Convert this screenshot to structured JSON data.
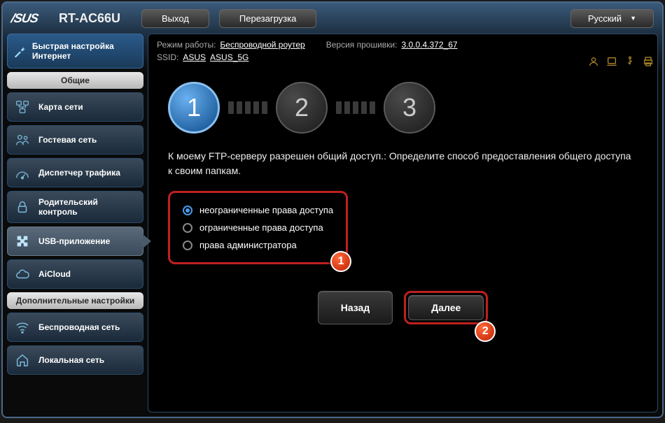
{
  "header": {
    "brand": "/SUS",
    "model": "RT-AC66U",
    "logout": "Выход",
    "reboot": "Перезагрузка",
    "language": "Русский"
  },
  "info": {
    "mode_label": "Режим работы:",
    "mode_value": "Беспроводной роутер",
    "fw_label": "Версия прошивки:",
    "fw_value": "3.0.0.4.372_67",
    "ssid_label": "SSID:",
    "ssid_1": "ASUS",
    "ssid_2": "ASUS_5G"
  },
  "sidebar": {
    "quick_setup": "Быстрая настройка Интернет",
    "general_header": "Общие",
    "items": [
      {
        "label": "Карта сети"
      },
      {
        "label": "Гостевая сеть"
      },
      {
        "label": "Диспетчер трафика"
      },
      {
        "label": "Родительский контроль"
      },
      {
        "label": "USB-приложение"
      },
      {
        "label": "AiCloud"
      }
    ],
    "advanced_header": "Дополнительные настройки",
    "adv_items": [
      {
        "label": "Беспроводная сеть"
      },
      {
        "label": "Локальная сеть"
      }
    ]
  },
  "main": {
    "instruction": "К моему FTP-серверу разрешен общий доступ.: Определите способ предоставления общего доступа к своим папкам.",
    "options": [
      "неограниченные права доступа",
      "ограниченные права доступа",
      "права администратора"
    ],
    "back": "Назад",
    "next": "Далее"
  },
  "annotations": {
    "b1": "1",
    "b2": "2"
  }
}
